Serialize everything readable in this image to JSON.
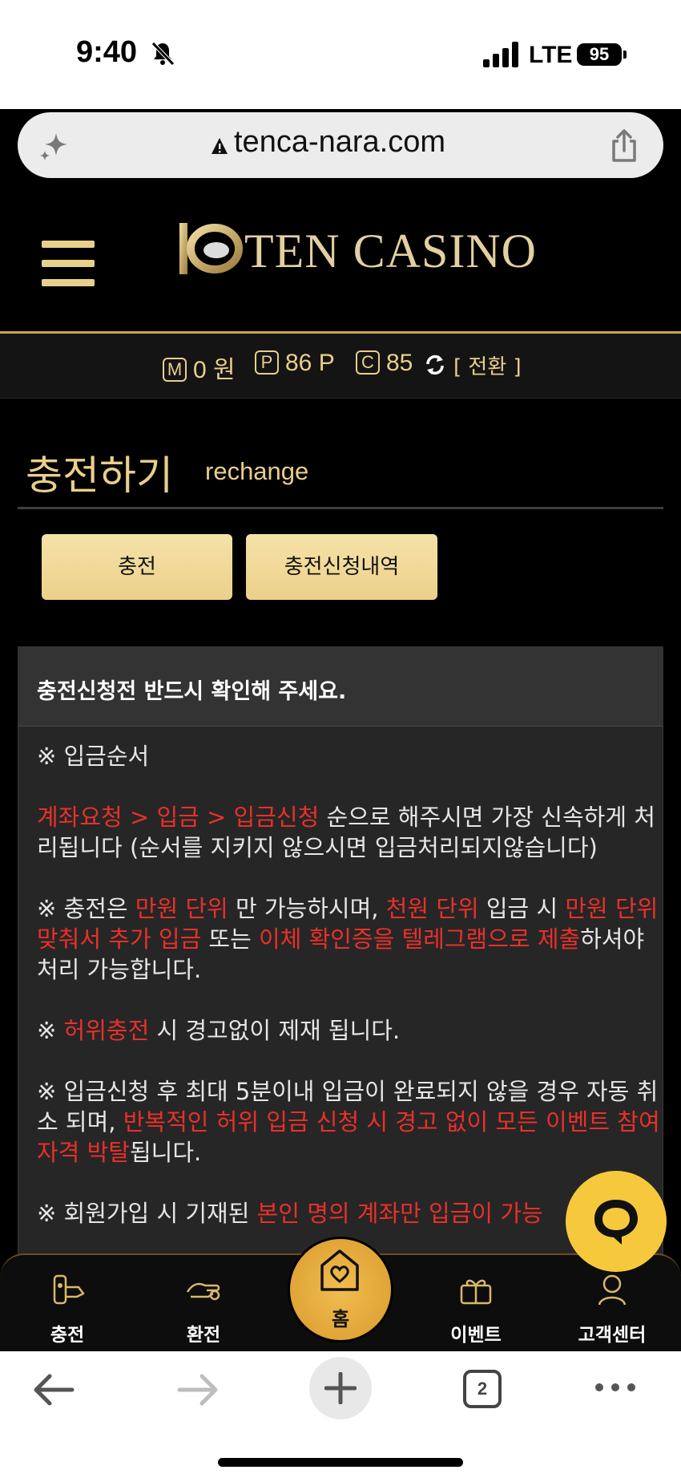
{
  "status_bar": {
    "time": "9:40",
    "network": "LTE",
    "battery": "95"
  },
  "browser": {
    "url": "tenca-nara.com",
    "tab_count": "2"
  },
  "site": {
    "brand": "TEN CASINO",
    "balance": {
      "money_badge": "M",
      "money_value": "0 원",
      "point_badge": "P",
      "point_value": "86 P",
      "coin_badge": "C",
      "coin_value": "85",
      "switch_label": "[ 전환 ]"
    },
    "page_title": "충전하기",
    "page_title_en": "rechange",
    "buttons": {
      "charge": "충전",
      "history": "충전신청내역"
    },
    "notice": {
      "heading": "충전신청전 반드시 확인해 주세요.",
      "p1_label": "※ 입금순서",
      "p2_red": "계좌요청 > 입금 > 입금신청",
      "p2_text": " 순으로 해주시면 가장 신속하게 처리됩니다 (순서를 지키지 않으시면 입금처리되지않습니다)",
      "p3_a": "※ 충전은 ",
      "p3_red1": "만원 단위",
      "p3_b": " 만 가능하시며, ",
      "p3_red2": "천원 단위",
      "p3_c": " 입금 시 ",
      "p3_red3": "만원 단위 맞춰서 추가 입금",
      "p3_d": " 또는 ",
      "p3_red4": "이체 확인증을 텔레그램으로 제출",
      "p3_e": "하셔야 처리 가능합니다.",
      "p4_a": "※ ",
      "p4_red": "허위충전",
      "p4_b": " 시 경고없이 제재 됩니다.",
      "p5_a": "※ 입금신청 후 최대 5분이내 입금이 완료되지 않을 경우 자동 취소 되며, ",
      "p5_red": "반복적인 허위 입금 신청 시 경고 없이 모든 이벤트 참여 자격 박탈",
      "p5_b": "됩니다.",
      "p6_a": "※ 회원가입 시 기재된 ",
      "p6_red": "본인 명의 계좌만 입금이 가능"
    },
    "bottom_nav": {
      "charge": "충전",
      "exchange": "환전",
      "home": "홈",
      "event": "이벤트",
      "support": "고객센터"
    }
  },
  "colors": {
    "gold": "#e9cf8a",
    "red": "#e8302a",
    "chat": "#f6c93c"
  }
}
